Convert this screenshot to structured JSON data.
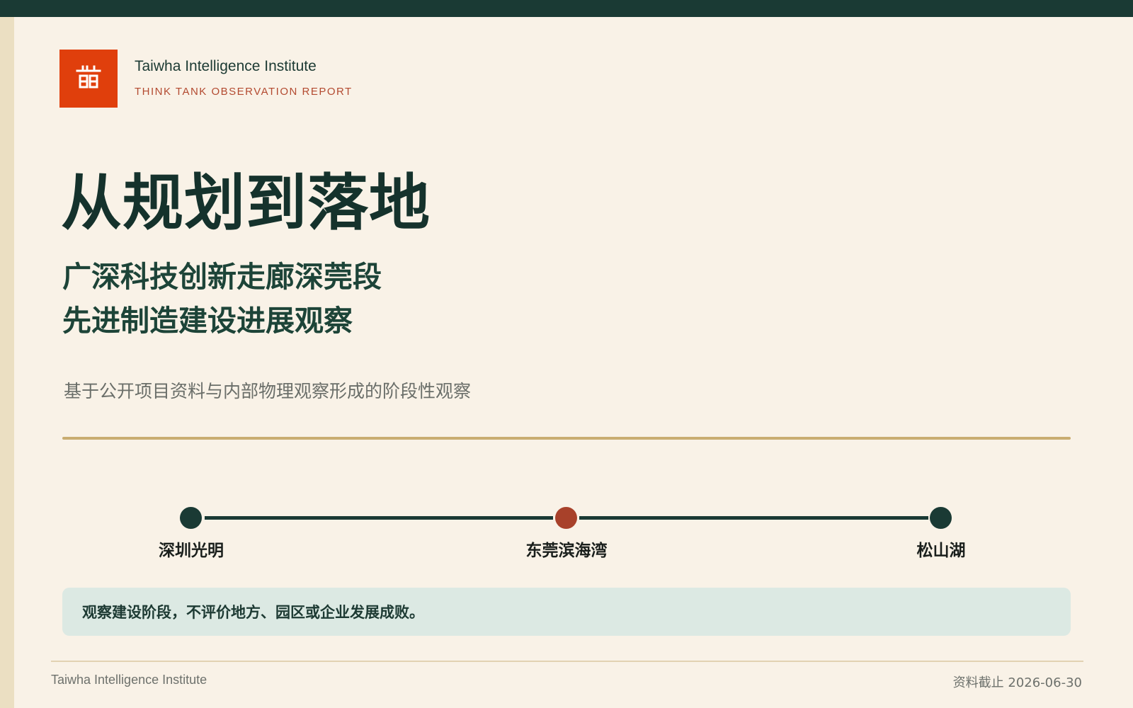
{
  "header": {
    "logo_icon": "gate-pavilion-icon",
    "org_name": "Taiwha Intelligence Institute",
    "org_tagline": "THINK TANK OBSERVATION REPORT"
  },
  "cover": {
    "title": "从规划到落地",
    "subtitle_line1": "广深科技创新走廊深莞段",
    "subtitle_line2": "先进制造建设进展观察",
    "description": "基于公开项目资料与内部物理观察形成的阶段性观察"
  },
  "timeline": {
    "stops": [
      {
        "label": "深圳光明",
        "color": "#1a3a34"
      },
      {
        "label": "东莞滨海湾",
        "color": "#a8412a"
      },
      {
        "label": "松山湖",
        "color": "#1a3a34"
      }
    ]
  },
  "note": {
    "text": "观察建设阶段，不评价地方、园区或企业发展成败。"
  },
  "footer": {
    "org_name": "Taiwha Intelligence Institute",
    "data_cutoff": "资料截止 2026-06-30"
  },
  "colors": {
    "top_bar": "#1a3a34",
    "logo_bg": "#e03f0c",
    "accent_gold": "#c9ad71",
    "page_bg": "#f9f2e7",
    "note_bg": "#dce9e3"
  }
}
